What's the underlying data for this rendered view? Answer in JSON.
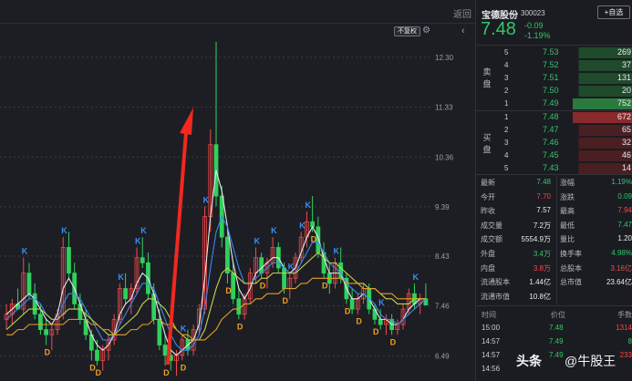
{
  "toolbar": {
    "back_label": "返回",
    "adj_label": "不复权",
    "gear_icon": "gear-icon",
    "collapse_icon": "chevron-left-icon"
  },
  "stock": {
    "name": "宝德股份",
    "code": "300023",
    "add_label": "+自选",
    "price": "7.48",
    "change_abs": "-0.09",
    "change_pct": "-1.19%"
  },
  "orderbook": {
    "sell_label": "卖\n盘",
    "buy_label": "买\n盘",
    "asks": [
      {
        "level": "5",
        "price": "7.53",
        "volume": "269"
      },
      {
        "level": "4",
        "price": "7.52",
        "volume": "37"
      },
      {
        "level": "3",
        "price": "7.51",
        "volume": "131"
      },
      {
        "level": "2",
        "price": "7.50",
        "volume": "20"
      },
      {
        "level": "1",
        "price": "7.49",
        "volume": "752"
      }
    ],
    "bids": [
      {
        "level": "1",
        "price": "7.48",
        "volume": "672"
      },
      {
        "level": "2",
        "price": "7.47",
        "volume": "65"
      },
      {
        "level": "3",
        "price": "7.46",
        "volume": "32"
      },
      {
        "level": "4",
        "price": "7.45",
        "volume": "46"
      },
      {
        "level": "5",
        "price": "7.43",
        "volume": "14"
      }
    ]
  },
  "stats": [
    {
      "k1": "最新",
      "v1": "7.48",
      "c1": "g",
      "k2": "涨幅",
      "v2": "1.19%",
      "c2": "g"
    },
    {
      "k1": "今开",
      "v1": "7.70",
      "c1": "r",
      "k2": "涨跌",
      "v2": "0.09",
      "c2": "g"
    },
    {
      "k1": "昨收",
      "v1": "7.57",
      "c1": "w",
      "k2": "最高",
      "v2": "7.94",
      "c2": "r"
    },
    {
      "k1": "成交量",
      "v1": "7.2万",
      "c1": "w",
      "k2": "最低",
      "v2": "7.47",
      "c2": "g"
    },
    {
      "k1": "成交额",
      "v1": "5554.9万",
      "c1": "w",
      "k2": "量比",
      "v2": "1.20",
      "c2": "w"
    },
    {
      "k1": "外盘",
      "v1": "3.4万",
      "c1": "g",
      "k2": "换手率",
      "v2": "4.98%",
      "c2": "g"
    },
    {
      "k1": "内盘",
      "v1": "3.8万",
      "c1": "r",
      "k2": "总股本",
      "v2": "3.16亿",
      "c2": "r"
    },
    {
      "k1": "流通股本",
      "v1": "1.44亿",
      "c1": "w",
      "k2": "总市值",
      "v2": "23.64亿",
      "c2": "w"
    },
    {
      "k1": "流通市值",
      "v1": "10.8亿",
      "c1": "w",
      "k2": "",
      "v2": "",
      "c2": "w"
    }
  ],
  "trades": {
    "headers": {
      "time": "时间",
      "price": "价位",
      "qty": "手数"
    },
    "rows": [
      {
        "time": "15:00",
        "price": "7.48",
        "qty": "1314"
      },
      {
        "time": "14:57",
        "price": "7.49",
        "qty": "8"
      },
      {
        "time": "14:57",
        "price": "7.49",
        "qty": "233"
      },
      {
        "time": "14:56",
        "price": "",
        "qty": ""
      }
    ]
  },
  "watermark": {
    "brand": "头条",
    "author": "@牛股王"
  },
  "chart_data": {
    "type": "candlestick",
    "y_axis_ticks": [
      "12.30",
      "11.33",
      "10.36",
      "9.39",
      "8.43",
      "7.46",
      "6.49"
    ],
    "ylim": [
      6.0,
      12.6
    ],
    "colors": {
      "up": "#ef4a4a",
      "down": "#2fd15c",
      "ma1": "#e8e8ea",
      "ma2": "#3b87f0",
      "ma3": "#c6d34c",
      "ma4": "#e0a12a",
      "arrow": "#f2281f"
    },
    "markers_k": [
      "K",
      "K",
      "K",
      "K",
      "K",
      "K",
      "K",
      "K",
      "K",
      "K",
      "K",
      "K",
      "K",
      "K",
      "K"
    ],
    "markers_d": [
      "D",
      "D",
      "D",
      "D",
      "D",
      "D",
      "D",
      "D",
      "D",
      "D",
      "D",
      "D",
      "D",
      "D",
      "D"
    ],
    "candles_ohlc": [
      [
        7.2,
        7.5,
        7.0,
        7.3
      ],
      [
        7.3,
        7.6,
        7.1,
        7.5
      ],
      [
        7.5,
        7.8,
        7.4,
        7.4
      ],
      [
        7.4,
        8.4,
        7.3,
        8.1
      ],
      [
        8.1,
        8.3,
        7.6,
        7.7
      ],
      [
        7.7,
        7.9,
        7.2,
        7.3
      ],
      [
        7.3,
        7.5,
        6.9,
        7.0
      ],
      [
        7.0,
        7.2,
        6.7,
        6.9
      ],
      [
        6.9,
        7.1,
        6.6,
        7.0
      ],
      [
        7.0,
        7.4,
        6.9,
        7.3
      ],
      [
        7.3,
        8.8,
        7.2,
        8.6
      ],
      [
        8.6,
        8.9,
        8.0,
        8.1
      ],
      [
        8.1,
        8.3,
        7.4,
        7.5
      ],
      [
        7.5,
        7.7,
        7.1,
        7.2
      ],
      [
        7.2,
        7.4,
        6.8,
        6.9
      ],
      [
        6.9,
        7.0,
        6.4,
        6.6
      ],
      [
        6.6,
        6.8,
        6.3,
        6.4
      ],
      [
        6.4,
        6.7,
        6.2,
        6.6
      ],
      [
        6.6,
        6.9,
        6.4,
        6.8
      ],
      [
        6.8,
        7.3,
        6.7,
        7.2
      ],
      [
        7.2,
        7.9,
        7.1,
        7.8
      ],
      [
        7.8,
        8.1,
        7.5,
        7.6
      ],
      [
        7.6,
        7.9,
        7.3,
        7.8
      ],
      [
        7.8,
        8.6,
        7.7,
        8.4
      ],
      [
        8.4,
        8.8,
        8.2,
        8.3
      ],
      [
        8.3,
        8.5,
        7.6,
        7.7
      ],
      [
        7.7,
        7.9,
        7.1,
        7.2
      ],
      [
        7.2,
        7.4,
        6.6,
        6.7
      ],
      [
        6.7,
        6.9,
        6.3,
        6.5
      ],
      [
        6.5,
        6.7,
        6.2,
        6.4
      ],
      [
        6.4,
        6.6,
        6.1,
        6.5
      ],
      [
        6.5,
        6.9,
        6.4,
        6.8
      ],
      [
        6.8,
        7.0,
        6.5,
        6.6
      ],
      [
        6.6,
        7.1,
        6.5,
        7.0
      ],
      [
        7.0,
        7.5,
        6.9,
        7.4
      ],
      [
        7.4,
        9.4,
        7.3,
        9.2
      ],
      [
        9.2,
        10.9,
        8.9,
        10.6
      ],
      [
        10.6,
        12.6,
        9.4,
        9.6
      ],
      [
        9.6,
        9.8,
        8.6,
        8.8
      ],
      [
        8.8,
        9.0,
        7.9,
        8.1
      ],
      [
        8.1,
        8.3,
        7.5,
        7.6
      ],
      [
        7.6,
        7.8,
        7.2,
        7.3
      ],
      [
        7.3,
        7.7,
        7.2,
        7.6
      ],
      [
        7.6,
        8.2,
        7.5,
        8.1
      ],
      [
        8.1,
        8.6,
        7.9,
        8.4
      ],
      [
        8.4,
        8.5,
        8.0,
        8.1
      ],
      [
        8.1,
        8.4,
        7.8,
        8.3
      ],
      [
        8.3,
        8.8,
        8.2,
        8.6
      ],
      [
        8.6,
        8.7,
        8.1,
        8.2
      ],
      [
        8.2,
        8.3,
        7.7,
        7.8
      ],
      [
        7.8,
        8.1,
        7.6,
        8.0
      ],
      [
        8.0,
        8.5,
        7.9,
        8.4
      ],
      [
        8.4,
        8.9,
        8.3,
        8.8
      ],
      [
        8.8,
        9.3,
        8.6,
        9.1
      ],
      [
        9.1,
        9.6,
        8.9,
        9.0
      ],
      [
        9.0,
        9.2,
        8.4,
        8.5
      ],
      [
        8.5,
        8.7,
        8.0,
        8.1
      ],
      [
        8.1,
        8.3,
        7.7,
        7.9
      ],
      [
        7.9,
        8.4,
        7.8,
        8.3
      ],
      [
        8.3,
        8.6,
        7.9,
        8.0
      ],
      [
        8.0,
        8.1,
        7.5,
        7.6
      ],
      [
        7.6,
        7.8,
        7.3,
        7.4
      ],
      [
        7.4,
        7.7,
        7.3,
        7.6
      ],
      [
        7.6,
        7.9,
        7.5,
        7.8
      ],
      [
        7.8,
        7.9,
        7.3,
        7.4
      ],
      [
        7.4,
        7.5,
        7.1,
        7.2
      ],
      [
        7.2,
        7.4,
        7.0,
        7.1
      ],
      [
        7.1,
        7.3,
        6.9,
        7.2
      ],
      [
        7.2,
        7.3,
        6.9,
        7.0
      ],
      [
        7.0,
        7.2,
        6.9,
        7.1
      ],
      [
        7.1,
        7.5,
        7.0,
        7.4
      ],
      [
        7.4,
        7.8,
        7.3,
        7.7
      ],
      [
        7.7,
        7.9,
        7.4,
        7.5
      ],
      [
        7.5,
        7.7,
        7.3,
        7.6
      ],
      [
        7.6,
        7.9,
        7.5,
        7.48
      ]
    ],
    "ma_series": {
      "ma1": [
        7.3,
        7.4,
        7.5,
        7.6,
        7.7,
        7.6,
        7.4,
        7.2,
        7.1,
        7.3,
        7.8,
        8.0,
        7.8,
        7.5,
        7.2,
        6.9,
        6.7,
        6.6,
        6.7,
        6.9,
        7.3,
        7.5,
        7.6,
        7.9,
        8.1,
        8.0,
        7.7,
        7.3,
        6.9,
        6.6,
        6.5,
        6.6,
        6.7,
        6.8,
        7.1,
        8.0,
        9.2,
        10.1,
        9.7,
        9.0,
        8.3,
        7.8,
        7.6,
        7.8,
        8.1,
        8.2,
        8.3,
        8.4,
        8.4,
        8.2,
        8.1,
        8.2,
        8.5,
        8.8,
        9.0,
        8.8,
        8.4,
        8.1,
        8.1,
        8.1,
        7.8,
        7.6,
        7.6,
        7.7,
        7.6,
        7.4,
        7.2,
        7.2,
        7.1,
        7.1,
        7.2,
        7.4,
        7.5,
        7.6,
        7.6
      ],
      "ma2": [
        7.2,
        7.3,
        7.4,
        7.5,
        7.6,
        7.6,
        7.5,
        7.3,
        7.2,
        7.2,
        7.5,
        7.7,
        7.7,
        7.6,
        7.4,
        7.2,
        7.0,
        6.8,
        6.8,
        6.9,
        7.1,
        7.3,
        7.5,
        7.7,
        7.9,
        7.9,
        7.8,
        7.5,
        7.2,
        6.9,
        6.7,
        6.6,
        6.6,
        6.7,
        6.9,
        7.4,
        8.2,
        8.9,
        9.2,
        9.0,
        8.6,
        8.2,
        7.9,
        7.9,
        8.0,
        8.1,
        8.2,
        8.3,
        8.3,
        8.2,
        8.1,
        8.1,
        8.3,
        8.5,
        8.7,
        8.7,
        8.5,
        8.3,
        8.2,
        8.1,
        7.9,
        7.8,
        7.7,
        7.7,
        7.6,
        7.5,
        7.3,
        7.2,
        7.2,
        7.1,
        7.2,
        7.3,
        7.4,
        7.5,
        7.6
      ],
      "ma3": [
        7.0,
        7.1,
        7.2,
        7.3,
        7.4,
        7.4,
        7.4,
        7.3,
        7.2,
        7.2,
        7.3,
        7.4,
        7.4,
        7.4,
        7.3,
        7.2,
        7.1,
        7.0,
        6.9,
        6.9,
        7.0,
        7.1,
        7.2,
        7.3,
        7.5,
        7.6,
        7.6,
        7.5,
        7.4,
        7.2,
        7.0,
        6.9,
        6.8,
        6.8,
        6.8,
        7.0,
        7.4,
        7.8,
        8.1,
        8.2,
        8.1,
        8.0,
        7.9,
        7.9,
        7.9,
        8.0,
        8.0,
        8.1,
        8.1,
        8.1,
        8.1,
        8.1,
        8.2,
        8.3,
        8.4,
        8.5,
        8.4,
        8.3,
        8.3,
        8.2,
        8.1,
        8.0,
        7.9,
        7.9,
        7.8,
        7.8,
        7.7,
        7.6,
        7.6,
        7.5,
        7.5,
        7.5,
        7.6,
        7.6,
        7.6
      ],
      "ma4": [
        6.9,
        6.9,
        7.0,
        7.0,
        7.1,
        7.1,
        7.1,
        7.1,
        7.1,
        7.1,
        7.1,
        7.2,
        7.2,
        7.2,
        7.2,
        7.1,
        7.1,
        7.0,
        7.0,
        6.9,
        6.9,
        6.9,
        7.0,
        7.0,
        7.1,
        7.1,
        7.2,
        7.2,
        7.1,
        7.1,
        7.0,
        6.9,
        6.9,
        6.8,
        6.8,
        6.8,
        6.9,
        7.0,
        7.2,
        7.3,
        7.4,
        7.4,
        7.5,
        7.5,
        7.6,
        7.6,
        7.7,
        7.7,
        7.7,
        7.8,
        7.8,
        7.8,
        7.9,
        7.9,
        8.0,
        8.0,
        8.0,
        8.0,
        8.0,
        8.0,
        7.9,
        7.9,
        7.9,
        7.8,
        7.8,
        7.8,
        7.7,
        7.7,
        7.7,
        7.6,
        7.6,
        7.6,
        7.6,
        7.6,
        7.6
      ]
    }
  }
}
